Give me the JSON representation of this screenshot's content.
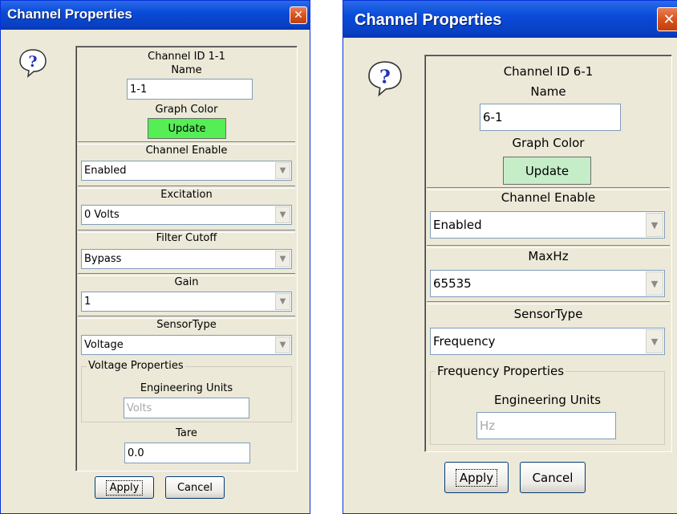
{
  "dialog1": {
    "title": "Channel Properties",
    "close_glyph": "✕",
    "help_icon": "help-question-icon",
    "channel_id": "Channel ID 1-1",
    "name_label": "Name",
    "name_value": "1-1",
    "graph_color_label": "Graph Color",
    "update_label": "Update",
    "update_color": "#55ee55",
    "channel_enable_label": "Channel Enable",
    "channel_enable_value": "Enabled",
    "excitation_label": "Excitation",
    "excitation_value": "0 Volts",
    "filter_cutoff_label": "Filter Cutoff",
    "filter_cutoff_value": "Bypass",
    "gain_label": "Gain",
    "gain_value": "1",
    "sensor_type_label": "SensorType",
    "sensor_type_value": "Voltage",
    "group_title": "Voltage Properties",
    "eng_units_label": "Engineering Units",
    "eng_units_value": "Volts",
    "tare_label": "Tare",
    "tare_value": "0.0",
    "apply_label": "Apply",
    "cancel_label": "Cancel"
  },
  "dialog2": {
    "title": "Channel Properties",
    "close_glyph": "✕",
    "help_icon": "help-question-icon",
    "channel_id": "Channel ID 6-1",
    "name_label": "Name",
    "name_value": "6-1",
    "graph_color_label": "Graph Color",
    "update_label": "Update",
    "update_color": "#c5eec8",
    "channel_enable_label": "Channel Enable",
    "channel_enable_value": "Enabled",
    "maxhz_label": "MaxHz",
    "maxhz_value": "65535",
    "sensor_type_label": "SensorType",
    "sensor_type_value": "Frequency",
    "group_title": "Frequency Properties",
    "eng_units_label": "Engineering Units",
    "eng_units_value": "Hz",
    "apply_label": "Apply",
    "cancel_label": "Cancel"
  }
}
